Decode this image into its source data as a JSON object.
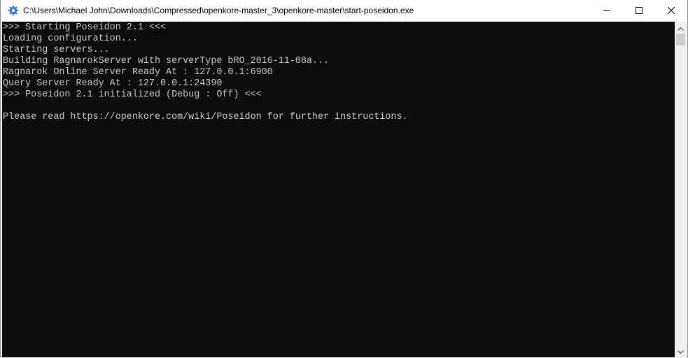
{
  "window": {
    "title": "C:\\Users\\Michael John\\Downloads\\Compressed\\openkore-master_3\\openkore-master\\start-poseidon.exe",
    "icon": "gear-icon"
  },
  "caption_buttons": {
    "minimize": "minimize-icon",
    "maximize": "maximize-icon",
    "close": "close-icon"
  },
  "console": {
    "background": "#0c0c0c",
    "text_color": "#cccccc",
    "lines": [
      ">>> Starting Poseidon 2.1 <<<",
      "Loading configuration...",
      "Starting servers...",
      "Building RagnarokServer with serverType bRO_2016-11-08a...",
      "Ragnarok Online Server Ready At : 127.0.0.1:6900",
      "Query Server Ready At : 127.0.0.1:24390",
      ">>> Poseidon 2.1 initialized (Debug : Off) <<<",
      "",
      "Please read https://openkore.com/wiki/Poseidon for further instructions."
    ]
  },
  "scrollbar": {
    "up_icon": "scroll-up-arrow-icon",
    "down_icon": "scroll-down-arrow-icon"
  }
}
